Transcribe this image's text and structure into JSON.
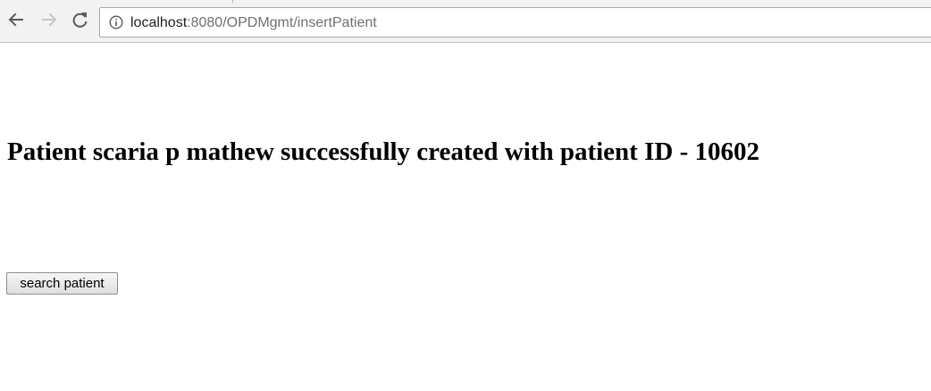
{
  "browser": {
    "url_host": "localhost",
    "url_rest": ":8080/OPDMgmt/insertPatient",
    "icons": {
      "back": "arrow-left-icon",
      "forward": "arrow-right-icon",
      "reload": "reload-icon",
      "site_info": "info-icon"
    }
  },
  "page": {
    "message": "Patient scaria p mathew successfully created with patient ID - 10602",
    "search_button_label": "search patient"
  },
  "colors": {
    "toolbar_background": "#f2f2f2",
    "page_background": "#ffffff",
    "heading_text": "#000000",
    "disabled_icon": "#c8c8c8",
    "active_icon": "#5a5a5a"
  }
}
